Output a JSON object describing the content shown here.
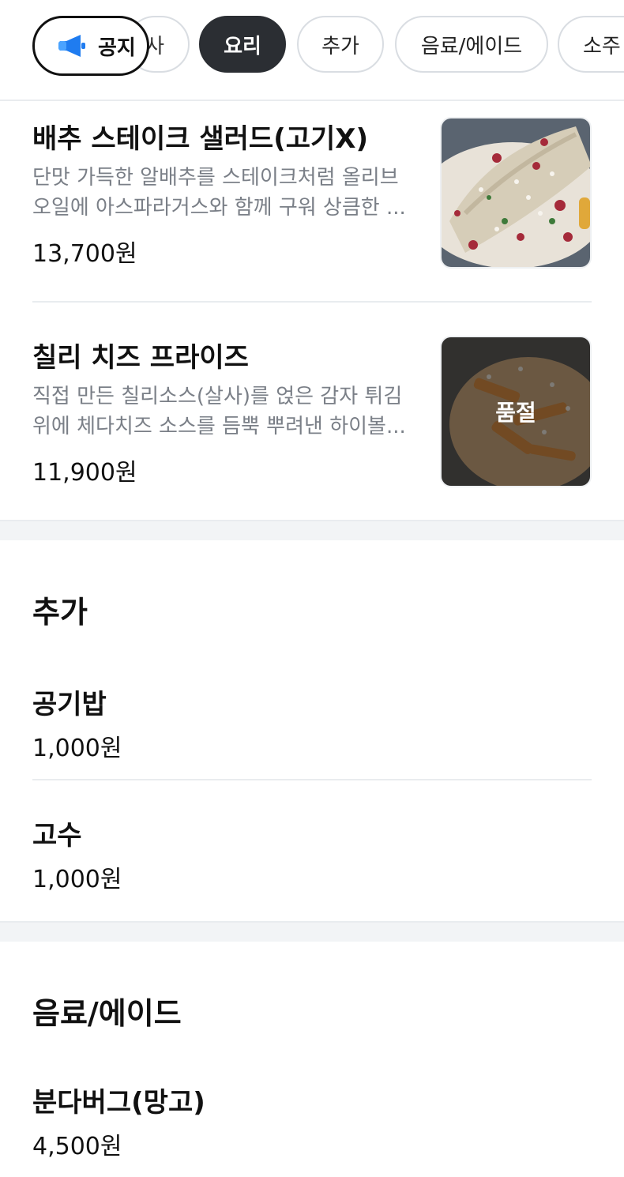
{
  "category_bar": {
    "notice_label": "공지",
    "chips": [
      {
        "label": "사",
        "active": false
      },
      {
        "label": "요리",
        "active": true
      },
      {
        "label": "추가",
        "active": false
      },
      {
        "label": "음료/에이드",
        "active": false
      },
      {
        "label": "소주",
        "active": false
      }
    ]
  },
  "section_yori": {
    "items": [
      {
        "name": "배추 스테이크 샐러드(고기X)",
        "desc_line1": "단맛 가득한 알배추를 스테이크처럼 올리브",
        "desc_line2": "오일에 아스파라거스와 함께 구워 상큼한 ...",
        "price": "13,700원"
      },
      {
        "name": "칠리 치즈 프라이즈",
        "desc_line1": "직접 만든 칠리소스(살사)를 얹은 감자 튀김",
        "desc_line2": "위에 체다치즈 소스를 듬뿍 뿌려낸 하이볼...",
        "price": "11,900원",
        "badge": "품절"
      }
    ]
  },
  "section_chuga": {
    "title": "추가",
    "items": [
      {
        "name": "공기밥",
        "price": "1,000원"
      },
      {
        "name": "고수",
        "price": "1,000원"
      }
    ]
  },
  "section_drink": {
    "title": "음료/에이드",
    "items": [
      {
        "name": "분다버그(망고)",
        "price": "4,500원"
      }
    ]
  },
  "colors": {
    "active_chip": "#2b2e33",
    "notice_icon": "#1f7cf0",
    "desc_text": "#7a7f87"
  }
}
